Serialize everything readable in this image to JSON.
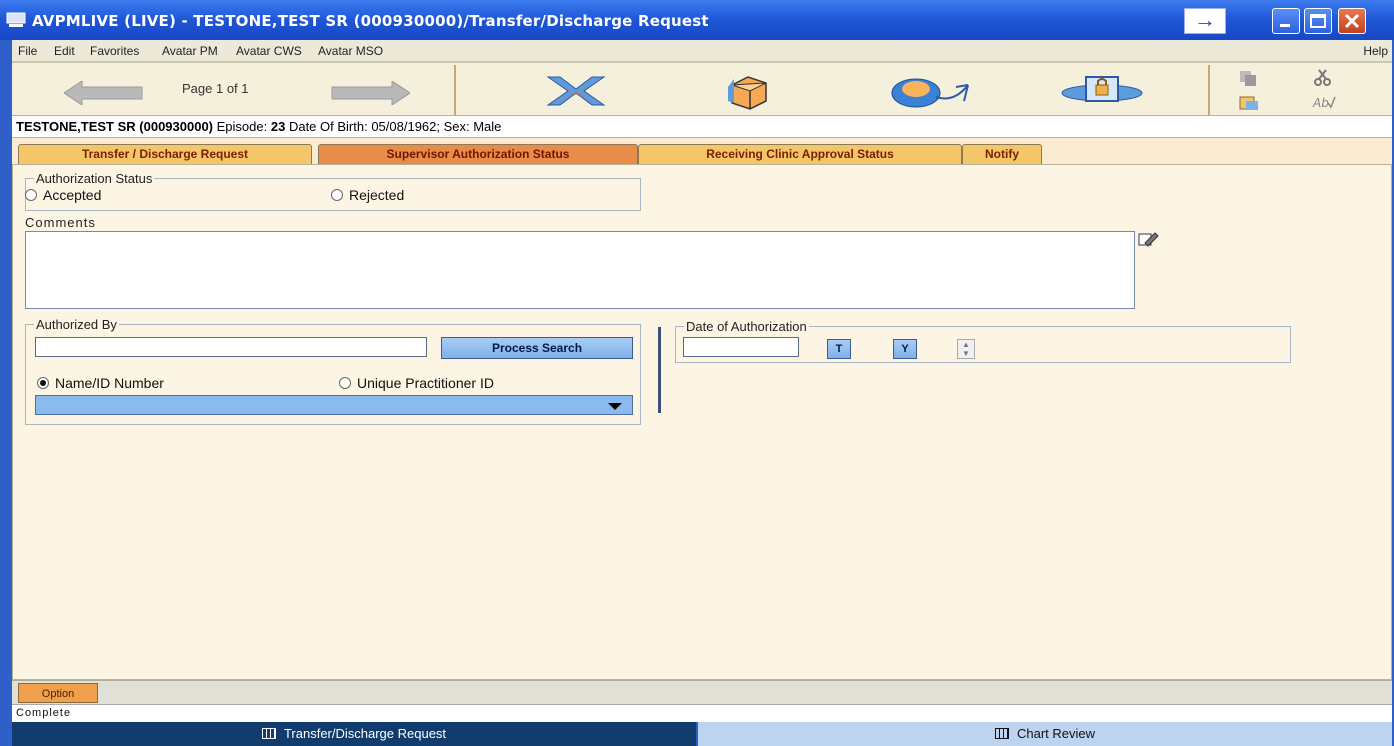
{
  "window": {
    "title": "AVPMLIVE (LIVE) - TESTONE,TEST SR (000930000)/Transfer/Discharge Request"
  },
  "menu": {
    "items": [
      "File",
      "Edit",
      "Favorites",
      "Avatar PM",
      "Avatar CWS",
      "Avatar MSO"
    ],
    "help": "Help"
  },
  "toolbar": {
    "page_label": "Page 1 of 1"
  },
  "patient": {
    "name": "TESTONE,TEST SR (000930000)",
    "episode_label": "Episode:",
    "episode": "23",
    "dob_text": "Date Of Birth: 05/08/1962; Sex: Male"
  },
  "tabs": [
    {
      "label": "Transfer / Discharge Request"
    },
    {
      "label": "Supervisor Authorization Status"
    },
    {
      "label": "Receiving Clinic Approval Status"
    },
    {
      "label": "Notify"
    }
  ],
  "form": {
    "authorization_status": {
      "legend": "Authorization Status",
      "accepted": "Accepted",
      "rejected": "Rejected"
    },
    "comments_label": "Comments",
    "authorized_by": {
      "legend": "Authorized By",
      "value": "",
      "process_search": "Process Search",
      "name_id": "Name/ID Number",
      "unique_id": "Unique Practitioner ID"
    },
    "date_of_authorization": {
      "legend": "Date of Authorization",
      "value": "",
      "today_btn": "T",
      "yesterday_btn": "Y"
    }
  },
  "option_tab": "Option",
  "status_text": "Complete",
  "taskbar": {
    "left": "Transfer/Discharge Request",
    "right": "Chart Review"
  },
  "colors": {
    "titlebar": "#1e56d6",
    "active_tab": "#e98c4a",
    "tab": "#f3c66a",
    "button_blue": "#7fb1ea"
  }
}
